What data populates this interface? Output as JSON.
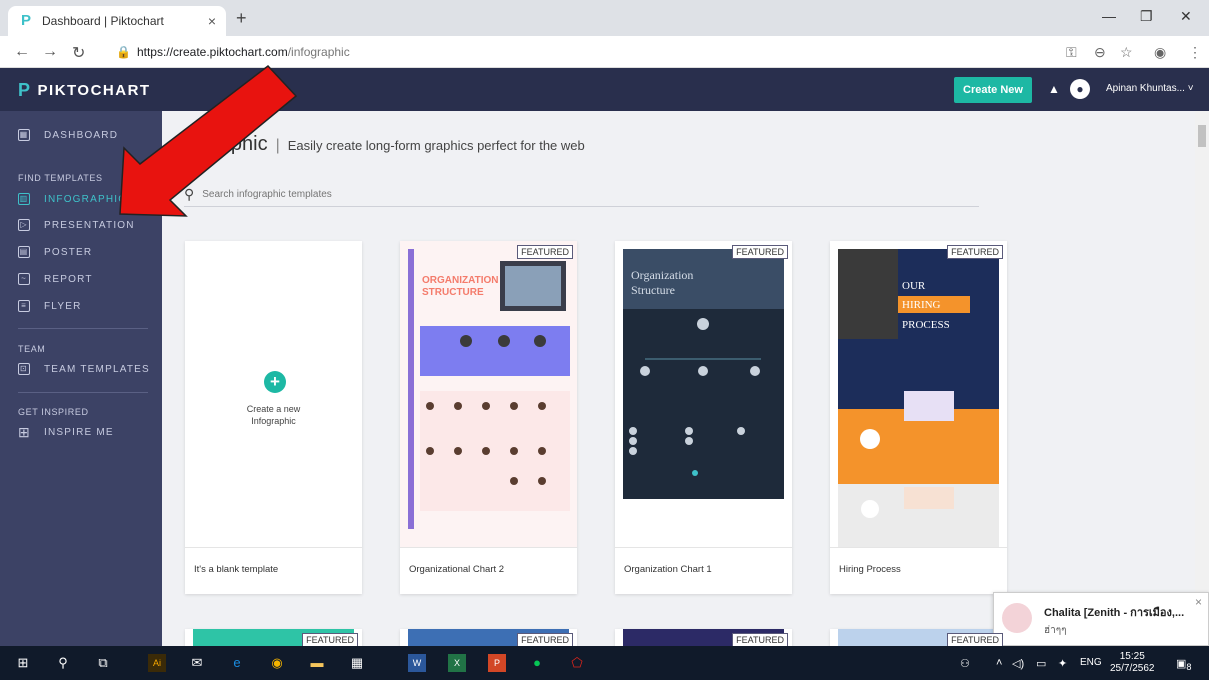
{
  "browser": {
    "tab_title": "Dashboard | Piktochart",
    "tab_close": "×",
    "new_tab": "+",
    "url_host": "https://create.piktochart.com",
    "url_path": "/infographic"
  },
  "app": {
    "logo": "PIKTOCHART",
    "create_new": "Create New",
    "user_name": "Apinan Khuntas..."
  },
  "sidebar": {
    "dashboard": "DASHBOARD",
    "find_templates": "FIND TEMPLATES",
    "items": [
      {
        "label": "INFOGRAPHIC"
      },
      {
        "label": "PRESENTATION"
      },
      {
        "label": "POSTER"
      },
      {
        "label": "REPORT"
      },
      {
        "label": "FLYER"
      }
    ],
    "team_head": "TEAM",
    "team_templates": "TEAM TEMPLATES",
    "get_inspired": "GET INSPIRED",
    "inspire_me": "INSPIRE ME"
  },
  "main": {
    "title": "Infographic",
    "title_partial": "graphic",
    "separator": "|",
    "subtitle": "Easily create long-form graphics perfect for the web",
    "search_placeholder": "Search infographic templates",
    "featured": "FEATURED",
    "blank_create": "Create a new",
    "blank_infographic": "Infographic",
    "cards": [
      {
        "label": "It's a blank template"
      },
      {
        "label": "Organizational Chart 2"
      },
      {
        "label": "Organization Chart 1"
      },
      {
        "label": "Hiring Process"
      }
    ]
  },
  "thumbs": {
    "org2_title_1": "ORGANIZATION",
    "org2_title_2": "STRUCTURE",
    "org1_title_1": "Organization",
    "org1_title_2": "Structure",
    "hiring_1": "OUR",
    "hiring_2": "HIRING",
    "hiring_3": "PROCESS"
  },
  "toast": {
    "name": "Chalita [Zenith - การเมือง,...",
    "message": "ฮ่าๆๆ",
    "close": "×"
  },
  "taskbar": {
    "lang": "ENG",
    "time": "15:25",
    "date": "25/7/2562",
    "notify_count": "8"
  },
  "colors": {
    "topbar": "#292f4d",
    "sidebar": "#3c4265",
    "accent": "#3ec1c9",
    "create_btn": "#1db8a4",
    "arrow": "#e8130f"
  }
}
